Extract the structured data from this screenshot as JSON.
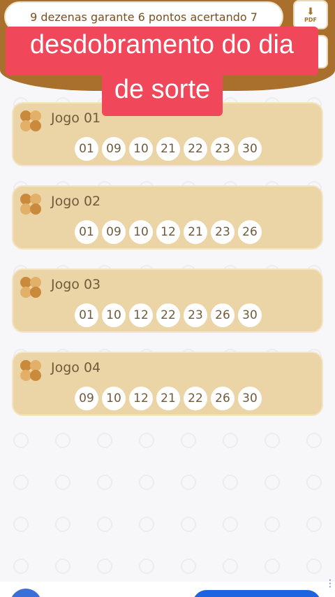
{
  "header": {
    "subtitle": "9 dezenas garante 6 pontos acertando 7",
    "pdf_label": "PDF",
    "pdf_icon": "download-pdf-icon",
    "home_icon": "home-icon"
  },
  "overlay": {
    "line1": "desdobramento do dia",
    "line2": "de sorte"
  },
  "colors": {
    "brand_brown": "#a8702c",
    "card_bg": "#ebd4a5",
    "overlay_red": "#f0485a"
  },
  "games": [
    {
      "title": "Jogo 01",
      "numbers": [
        "01",
        "09",
        "10",
        "21",
        "22",
        "23",
        "30"
      ]
    },
    {
      "title": "Jogo 02",
      "numbers": [
        "01",
        "09",
        "10",
        "12",
        "21",
        "23",
        "26"
      ]
    },
    {
      "title": "Jogo 03",
      "numbers": [
        "01",
        "10",
        "12",
        "22",
        "23",
        "26",
        "30"
      ]
    },
    {
      "title": "Jogo 04",
      "numbers": [
        "09",
        "10",
        "12",
        "21",
        "22",
        "26",
        "30"
      ]
    }
  ]
}
